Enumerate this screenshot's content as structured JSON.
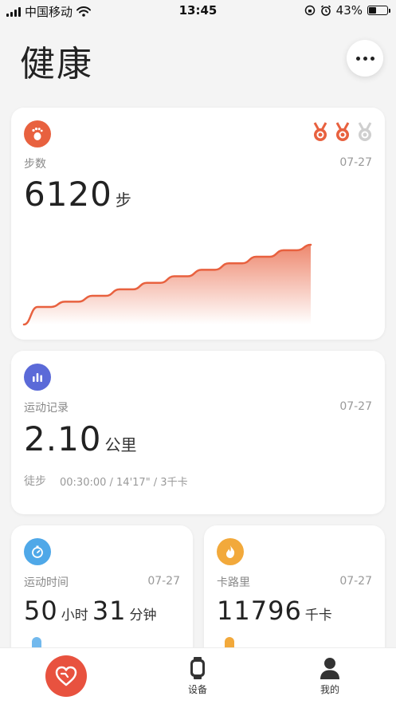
{
  "status_bar": {
    "carrier": "中国移动",
    "time": "13:45",
    "battery_text": "43%",
    "battery_level": 0.43
  },
  "header": {
    "title": "健康",
    "more_icon": "more-horizontal-icon"
  },
  "steps_card": {
    "icon": "footprint-icon",
    "icon_color": "#e8613f",
    "label": "步数",
    "date": "07-27",
    "value": "6120",
    "unit": "步",
    "medals": [
      {
        "icon": "medal-icon",
        "earned": true
      },
      {
        "icon": "medal-icon",
        "earned": true
      },
      {
        "icon": "medal-icon",
        "earned": false
      }
    ],
    "chart_data": {
      "type": "area",
      "series": [
        {
          "values": [
            0,
            1350,
            1350,
            1750,
            1750,
            2200,
            2200,
            2700,
            2700,
            3200,
            3200,
            3700,
            3700,
            4200,
            4200,
            4700,
            4700,
            5200,
            5200,
            5700,
            5700,
            6120
          ]
        }
      ],
      "ylim": [
        0,
        6120
      ]
    }
  },
  "workout_card": {
    "icon": "bar-chart-icon",
    "icon_color": "#5b6ad8",
    "label": "运动记录",
    "date": "07-27",
    "value": "2.10",
    "unit": "公里",
    "activity": "徒步",
    "details": "00:30:00 / 14'17\" / 3千卡"
  },
  "duration_card": {
    "icon": "stopwatch-icon",
    "icon_color": "#4fa8e8",
    "label": "运动时间",
    "date": "07-27",
    "hours": "50",
    "hours_unit": "小时",
    "minutes": "31",
    "minutes_unit": "分钟"
  },
  "calories_card": {
    "icon": "flame-icon",
    "icon_color": "#f2a93b",
    "label": "卡路里",
    "date": "07-27",
    "value": "11796",
    "unit": "千卡"
  },
  "tab_bar": {
    "tabs": [
      {
        "label": "",
        "icon": "heart-icon",
        "active": true
      },
      {
        "label": "设备",
        "icon": "watch-icon"
      },
      {
        "label": "我的",
        "icon": "person-icon"
      }
    ]
  }
}
